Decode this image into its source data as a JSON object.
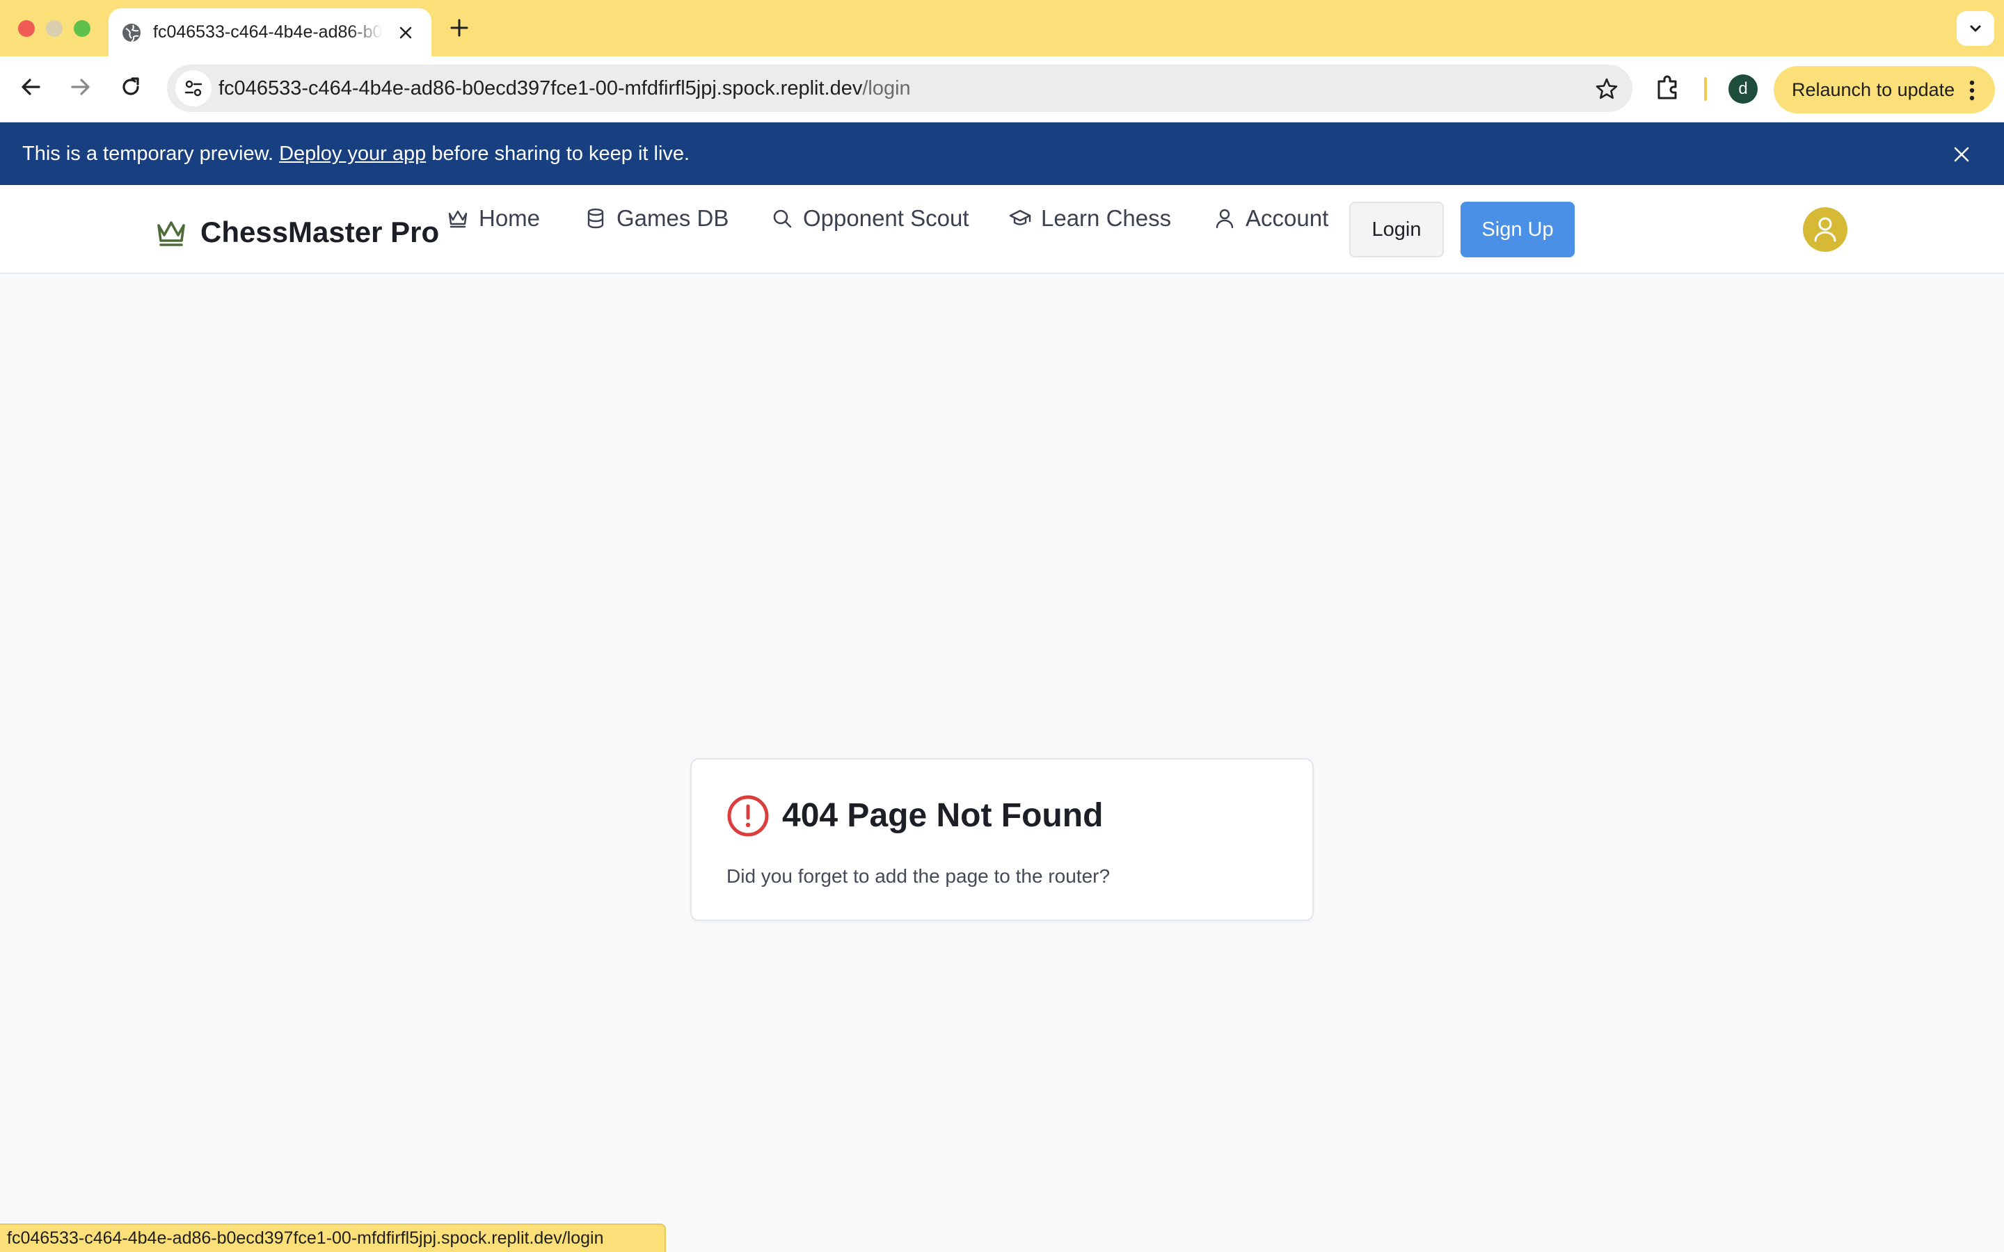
{
  "browser": {
    "tab_title": "fc046533-c464-4b4e-ad86-b0ecd397fce1-00-mfdfirfl5jpj.spock.replit.dev",
    "url_host": "fc046533-c464-4b4e-ad86-b0ecd397fce1-00-mfdfirfl5jpj.spock.replit.dev",
    "url_path": "/login",
    "profile_initial": "d",
    "relaunch_label": "Relaunch to update",
    "status_url": "fc046533-c464-4b4e-ad86-b0ecd397fce1-00-mfdfirfl5jpj.spock.replit.dev/login"
  },
  "banner": {
    "text_before": "This is a temporary preview. ",
    "link": "Deploy your app",
    "text_after": " before sharing to keep it live."
  },
  "app": {
    "brand": "ChessMaster Pro",
    "nav": [
      {
        "label": "Home",
        "icon": "crown-icon"
      },
      {
        "label": "Games DB",
        "icon": "database-icon"
      },
      {
        "label": "Opponent Scout",
        "icon": "search-icon"
      },
      {
        "label": "Learn Chess",
        "icon": "graduation-cap-icon"
      },
      {
        "label": "Account",
        "icon": "user-icon"
      }
    ],
    "login_label": "Login",
    "signup_label": "Sign Up"
  },
  "error": {
    "title": "404 Page Not Found",
    "message": "Did you forget to add the page to the router?"
  },
  "colors": {
    "tabstrip": "#fbe07a",
    "banner": "#183f7f",
    "signup": "#4a90e6",
    "avatar": "#d6b935",
    "error_icon": "#dc3e3e",
    "brand_icon": "#4f6b3a"
  }
}
